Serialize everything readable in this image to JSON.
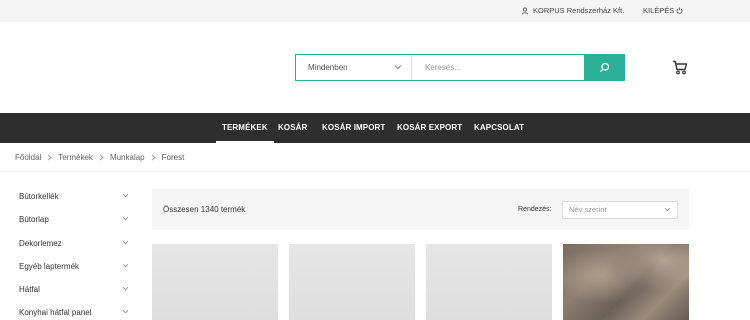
{
  "topbar": {
    "user_name": "KORPUS Rendszerház Kft.",
    "logout_label": "KILÉPÉS"
  },
  "search": {
    "scope_value": "Mindenben",
    "placeholder": "Keresés..."
  },
  "nav": {
    "items": [
      "TERMÉKEK",
      "KOSÁR",
      "KOSÁR IMPORT",
      "KOSÁR EXPORT",
      "KAPCSOLAT"
    ],
    "active": "TERMÉKEK"
  },
  "breadcrumb": {
    "items": [
      "Főoldal",
      "Termékek",
      "Munkalap",
      "Forest"
    ]
  },
  "sidebar": {
    "categories": [
      "Bútorkellék",
      "Bútorlap",
      "Dekorlemez",
      "Egyéb laptermék",
      "Hátfal",
      "Konyhai hátfal panel"
    ]
  },
  "toolbar": {
    "count_text": "Összesen 1340 termék",
    "sort_label": "Rendezés:",
    "sort_value": "Név szerint"
  },
  "colors": {
    "accent": "#2db09a",
    "nav_bg": "#2e2e2e"
  },
  "icons": {
    "user": "user-icon",
    "logout": "power-icon",
    "search": "search-icon",
    "cart": "cart-icon",
    "chevron": "chevron-down-icon",
    "breadcrumb_sep": "chevron-right-icon"
  }
}
